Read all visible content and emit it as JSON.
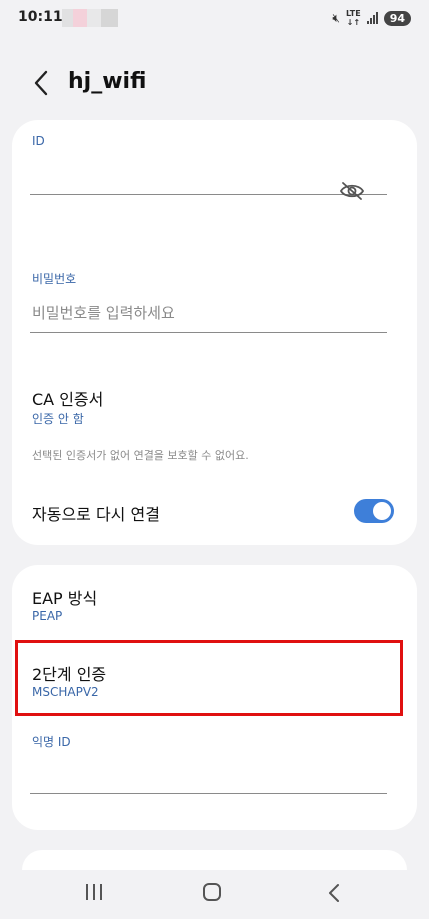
{
  "status_bar": {
    "time": "10:11",
    "network": "LTE",
    "battery": "94"
  },
  "header": {
    "title": "hj_wifi"
  },
  "form": {
    "id_label": "ID",
    "id_value": "",
    "password_label": "비밀번호",
    "password_placeholder": "비밀번호를 입력하세요",
    "ca_cert_title": "CA 인증서",
    "ca_cert_value": "인증 안 함",
    "ca_cert_hint": "선택된 인증서가 없어 연결을 보호할 수 없어요.",
    "auto_reconnect_label": "자동으로 다시 연결",
    "auto_reconnect_on": true
  },
  "eap": {
    "method_title": "EAP 방식",
    "method_value": "PEAP",
    "phase2_title": "2단계 인증",
    "phase2_value": "MSCHAPV2",
    "anonymous_id_label": "익명 ID",
    "anonymous_id_value": ""
  },
  "colors": {
    "accent": "#3e7fd9",
    "link": "#3a67a8",
    "highlight": "#e01010"
  }
}
